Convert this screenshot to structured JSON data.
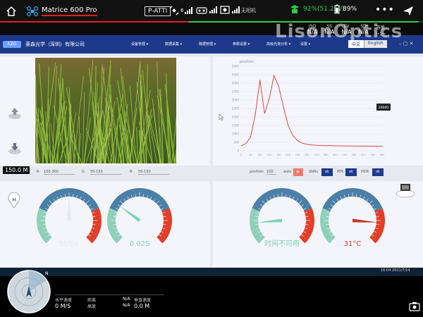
{
  "topbar": {
    "drone_name": "Matrice 600 Pro",
    "flight_mode": "P-ATTI",
    "sat_count": "6",
    "hd_label": "无相机",
    "battery_main": "92%(51.25V)",
    "battery_rc": "89%",
    "more_label": "•••",
    "flight_progress": 0.45
  },
  "camera_params": [
    {
      "label": "ISO",
      "value": "N/A"
    },
    {
      "label": "SS",
      "value": "N/A"
    },
    {
      "label": "EV",
      "value": "N/A"
    },
    {
      "label": "SD",
      "value": "N/A"
    },
    {
      "label": "容量",
      "value": "--:--"
    }
  ],
  "watermark": "LisonOptics",
  "navbar": {
    "logo": "EZO",
    "company": "莱森光学（深圳）有限公司",
    "menu": [
      "设备管理 ▾",
      "数据采集 ▾",
      "数据管理 ▾",
      "参数设置 ▾",
      "高级光谱分析 ▾",
      "设置 ▾"
    ],
    "lang_cn": "中文",
    "lang_en": "English",
    "win_controls": "–  ▢  ✕"
  },
  "controls": {
    "r_label": "R",
    "r_value": "100-300",
    "g_label": "G",
    "g_value": "50-150",
    "b_label": "B",
    "b_value": "50-150",
    "position_label": "position",
    "position_value": "100",
    "auto_label": "auto",
    "btn_auto": "▶",
    "snr_label": "SNRs",
    "btn_snr": "ok",
    "rtk_label": "RTK",
    "btn_rtk": "ok",
    "hdr_label": "HDR",
    "btn_hdr": "ok"
  },
  "altitude": "150.0 M",
  "chart_data": {
    "type": "line",
    "title": "position",
    "tooltip": "20000",
    "x": [
      0,
      20,
      40,
      60,
      80,
      100,
      120,
      140,
      160,
      180,
      200,
      220,
      240,
      260,
      280,
      300,
      320,
      340,
      360,
      380,
      400,
      420,
      440,
      460,
      480,
      500,
      520,
      540,
      560,
      580,
      600
    ],
    "y": [
      300,
      420,
      800,
      2100,
      4200,
      2200,
      3100,
      4450,
      3800,
      2600,
      1500,
      900,
      600,
      450,
      380,
      340,
      320,
      310,
      300,
      300,
      290,
      290,
      280,
      280,
      280,
      275,
      275,
      270,
      270,
      270,
      270
    ],
    "ylim": [
      0,
      5000
    ],
    "ytick_labels": [
      "5000",
      "4500",
      "4000",
      "3500",
      "3000",
      "2500",
      "2000",
      "1500",
      "1000",
      "500",
      "0"
    ],
    "grid": true,
    "color": "#d94a4a"
  },
  "gauges": [
    {
      "name": "fps-gauge",
      "value_text": "50fps",
      "fraction": 0.5,
      "needle_color": "#e6e8ee",
      "label_color": "#e6e8ee"
    },
    {
      "name": "exposure-gauge",
      "value_text": "0.02S",
      "fraction": 0.3,
      "needle_color": "#7fd1b4",
      "label_color": "#7fd1b4"
    },
    {
      "name": "time-gauge",
      "value_text": "时间不可用",
      "fraction": 0.15,
      "needle_color": "#7fd1b4",
      "label_color": "#7fd1b4"
    },
    {
      "name": "temperature-gauge",
      "value_text": "31°C",
      "fraction": 0.85,
      "needle_color": "#c0392b",
      "label_color": "#e03a2f"
    }
  ],
  "taskbar": {
    "time": "16:04",
    "date": "2021/7/14"
  },
  "telemetry": {
    "speed_h_label": "水平速度",
    "speed_h_value": "0 M/S",
    "dist_label": "距离",
    "dist_value": "N/A",
    "height_label": "高度",
    "height_value": "N/A",
    "speed_v_label": "垂直速度",
    "speed_v_value": "0.0 M"
  }
}
